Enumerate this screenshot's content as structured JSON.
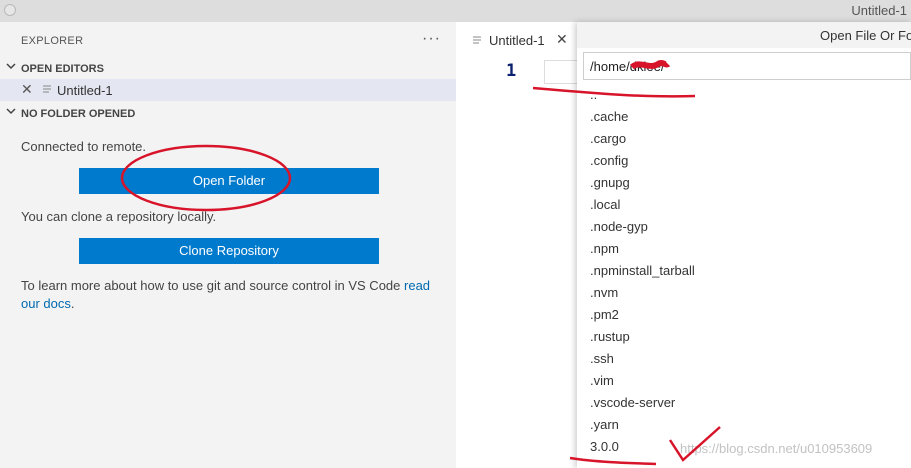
{
  "window": {
    "title": "Untitled-1"
  },
  "explorer": {
    "title": "EXPLORER",
    "more_icon": "ellipsis-icon",
    "open_editors_header": "OPEN EDITORS",
    "open_editor_file": "Untitled-1",
    "no_folder_header": "NO FOLDER OPENED",
    "connected_msg": "Connected to remote.",
    "open_folder_button": "Open Folder",
    "clone_msg": "You can clone a repository locally.",
    "clone_button": "Clone Repository",
    "learn_text": "To learn more about how to use git and source control in VS Code",
    "learn_link": "read our docs",
    "learn_suffix": "."
  },
  "editor": {
    "tab_label": "Untitled-1",
    "line_number": "1"
  },
  "dialog": {
    "title": "Open File Or Folder",
    "path_value": "/home/dklee/",
    "entries": [
      "..",
      ".cache",
      ".cargo",
      ".config",
      ".gnupg",
      ".local",
      ".node-gyp",
      ".npm",
      ".npminstall_tarball",
      ".nvm",
      ".pm2",
      ".rustup",
      ".ssh",
      ".vim",
      ".vscode-server",
      ".yarn",
      "3.0.0"
    ]
  },
  "watermark": "https://blog.csdn.net/u010953609",
  "colors": {
    "accent": "#007acc",
    "link": "#006ab1",
    "annotation": "#d8142a"
  }
}
